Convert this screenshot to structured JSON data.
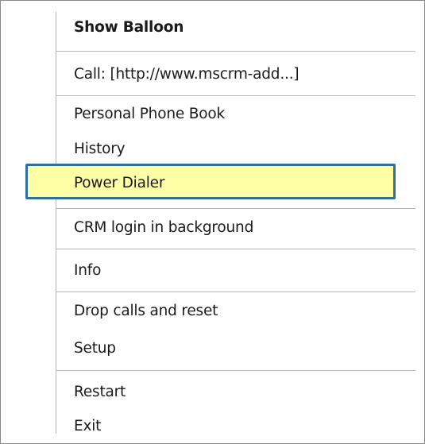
{
  "menu": {
    "items": [
      {
        "label": "Show Balloon"
      },
      {
        "label": "Call: [http://www.mscrm-add...]"
      },
      {
        "label": "Personal Phone Book"
      },
      {
        "label": "History"
      },
      {
        "label": "Power Dialer"
      },
      {
        "label": "CRM login in background"
      },
      {
        "label": "Info"
      },
      {
        "label": "Drop calls and reset"
      },
      {
        "label": "Setup"
      },
      {
        "label": "Restart"
      },
      {
        "label": "Exit"
      }
    ],
    "highlighted_item": "Power Dialer",
    "colors": {
      "highlight_fill": "#ffffa6",
      "highlight_border": "#2f6e9f"
    }
  }
}
